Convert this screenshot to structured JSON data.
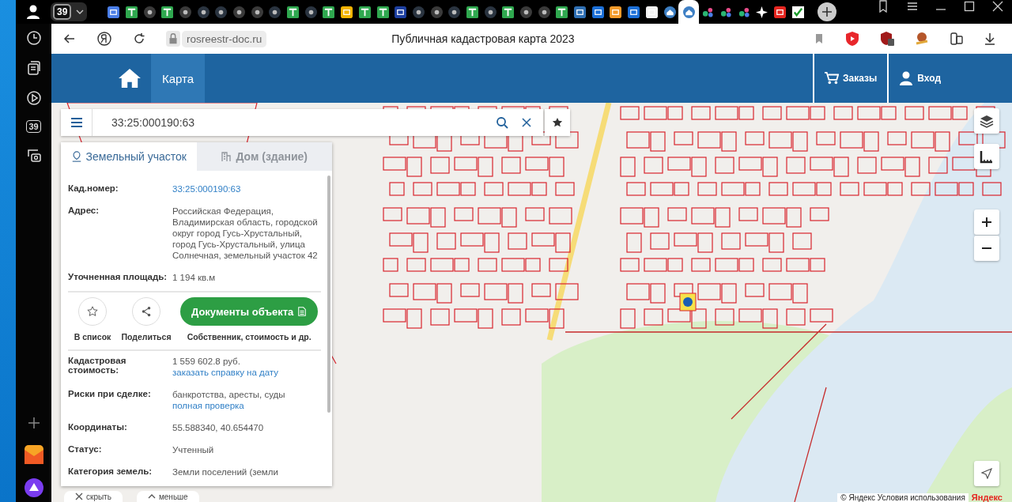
{
  "browser": {
    "tab_count": "39",
    "favicons": [
      {
        "kind": "doc",
        "selected": false
      },
      {
        "kind": "sheet",
        "selected": false
      },
      {
        "kind": "dim",
        "selected": false
      },
      {
        "kind": "sheet",
        "selected": false
      },
      {
        "kind": "dim",
        "selected": false
      },
      {
        "kind": "gc",
        "selected": false
      },
      {
        "kind": "gc",
        "selected": false
      },
      {
        "kind": "dim",
        "selected": false
      },
      {
        "kind": "dim",
        "selected": false
      },
      {
        "kind": "gc",
        "selected": false
      },
      {
        "kind": "sheet",
        "selected": false
      },
      {
        "kind": "gc",
        "selected": false
      },
      {
        "kind": "sheet",
        "selected": false
      },
      {
        "kind": "drive",
        "selected": false
      },
      {
        "kind": "sheet",
        "selected": false
      },
      {
        "kind": "sheet",
        "selected": false
      },
      {
        "kind": "eagle",
        "selected": false
      },
      {
        "kind": "gc",
        "selected": false
      },
      {
        "kind": "dim",
        "selected": false
      },
      {
        "kind": "gc",
        "selected": false
      },
      {
        "kind": "sheet",
        "selected": false
      },
      {
        "kind": "gc",
        "selected": false
      },
      {
        "kind": "sheet",
        "selected": false
      },
      {
        "kind": "dim",
        "selected": false
      },
      {
        "kind": "dim",
        "selected": false
      },
      {
        "kind": "sheet",
        "selected": false
      },
      {
        "kind": "at",
        "selected": false
      },
      {
        "kind": "mail",
        "selected": false
      },
      {
        "kind": "cloud",
        "selected": false
      },
      {
        "kind": "mail",
        "selected": false
      },
      {
        "kind": "ticket",
        "selected": false
      },
      {
        "kind": "home",
        "selected": false
      },
      {
        "kind": "home",
        "selected": true
      },
      {
        "kind": "dots",
        "selected": false
      },
      {
        "kind": "dots",
        "selected": false
      },
      {
        "kind": "dots",
        "selected": false
      },
      {
        "kind": "sparkle",
        "selected": false
      },
      {
        "kind": "ya",
        "selected": false
      },
      {
        "kind": "check",
        "selected": false
      }
    ],
    "url": "rosreestr-doc.ru",
    "page_title": "Публичная кадастровая карта 2023",
    "sidebar_badge": "39"
  },
  "site_header": {
    "nav": [
      {
        "label": "Карта",
        "selected": true
      }
    ],
    "actions": [
      {
        "label": "Заказы",
        "kind": "cart"
      },
      {
        "label": "Вход",
        "kind": "user"
      }
    ]
  },
  "search": {
    "value": "33:25:000190:63"
  },
  "panel": {
    "tabs": [
      {
        "label": "Земельный участок",
        "selected": true
      },
      {
        "label": "Дом (здание)",
        "selected": false
      }
    ],
    "fields_top": [
      {
        "label": "Кад.номер:",
        "link": "33:25:000190:63"
      },
      {
        "label": "Адрес:",
        "value": "Российская Федерация, Владимирская область, городской округ город Гусь-Хрустальный, город Гусь-Хрустальный, улица Солнечная, земельный участок 42"
      },
      {
        "label": "Уточненная площадь:",
        "value": "1 194 кв.м"
      }
    ],
    "actions": [
      {
        "label": "В список",
        "kind": "star"
      },
      {
        "label": "Поделиться",
        "kind": "share"
      }
    ],
    "documents_button": "Документы объекта",
    "documents_caption": "Собственник, стоимость и др.",
    "fields_bottom": [
      {
        "label": "Кадастровая стоимость:",
        "value": "1 559 602.8 руб.",
        "link": "заказать справку на дату"
      },
      {
        "label": "Риски при сделке:",
        "value": "банкротства, аресты, суды",
        "link": "полная проверка"
      },
      {
        "label": "Координаты:",
        "value": "55.588340, 40.654470"
      },
      {
        "label": "Статус:",
        "value": "Учтенный"
      },
      {
        "label": "Категория земель:",
        "value": "Земли поселений (земли"
      }
    ]
  },
  "bottom_buttons": [
    {
      "label": "скрыть",
      "kind": "close"
    },
    {
      "label": "меньше",
      "kind": "up"
    }
  ],
  "attribution": "© Яндекс Условия использования",
  "map_logo": "Яндекс"
}
